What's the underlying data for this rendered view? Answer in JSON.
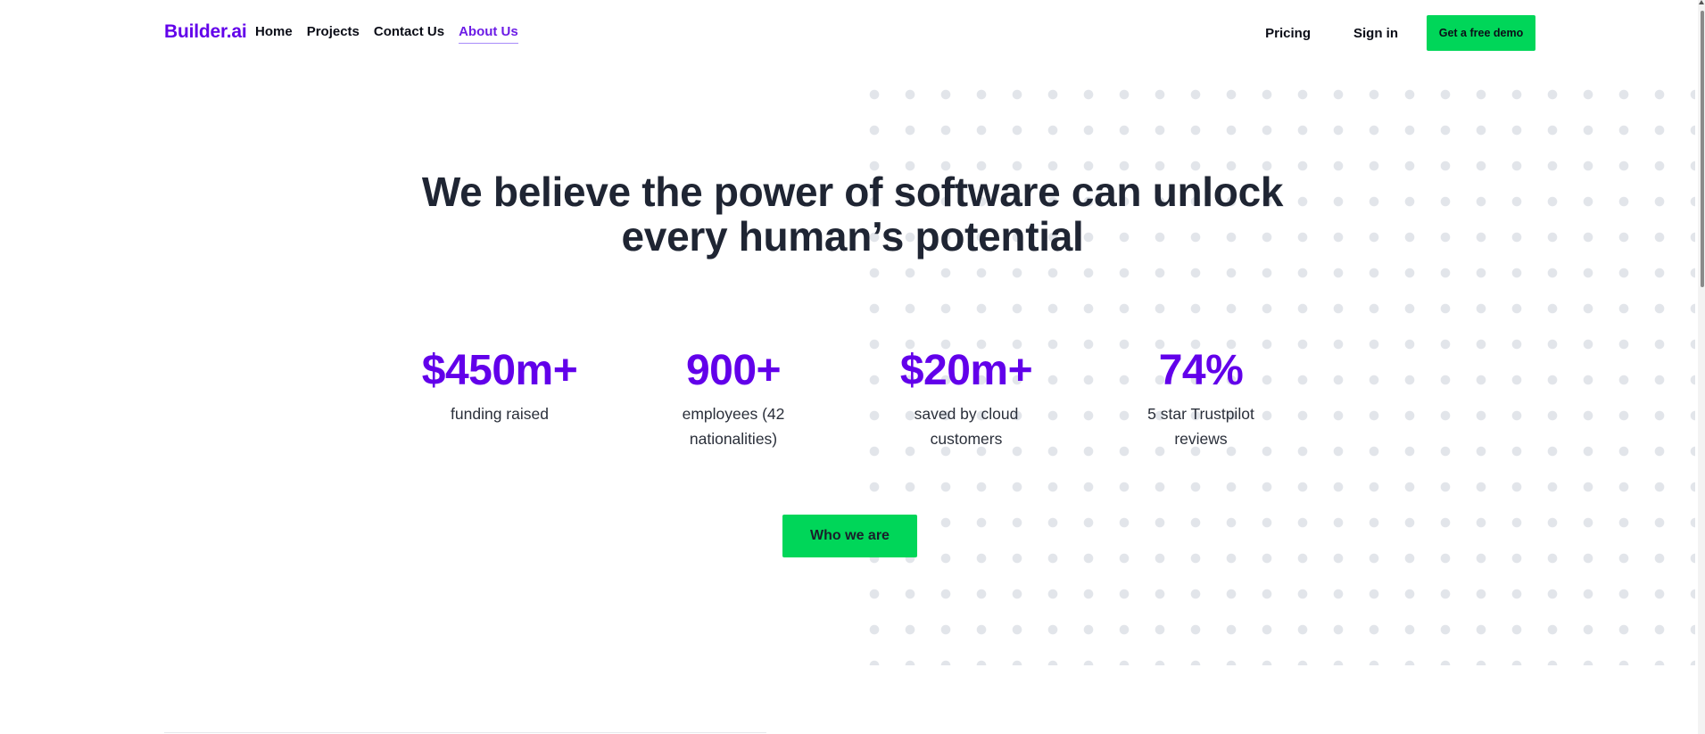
{
  "header": {
    "logo": "Builder.ai",
    "nav_links": [
      "Home",
      "Projects",
      "Contact Us",
      "About Us"
    ],
    "active_link": "About Us",
    "pricing": "Pricing",
    "sign_in": "Sign in",
    "demo_button": "Get a free demo"
  },
  "hero": {
    "title_line1": "We believe the power of software can unlock",
    "title_line2": "every human’s potential",
    "stats": [
      {
        "value": "$450m+",
        "label": "funding raised"
      },
      {
        "value": "900+",
        "label": "employees (42 nationalities)"
      },
      {
        "value": "$20m+",
        "label": "saved by cloud customers"
      },
      {
        "value": "74%",
        "label": "5 star Trustpilot reviews"
      }
    ],
    "cta_button": "Who we are"
  },
  "colors": {
    "brand": "#6200ea",
    "cta_green": "#00d659",
    "heading": "#1f2533"
  }
}
